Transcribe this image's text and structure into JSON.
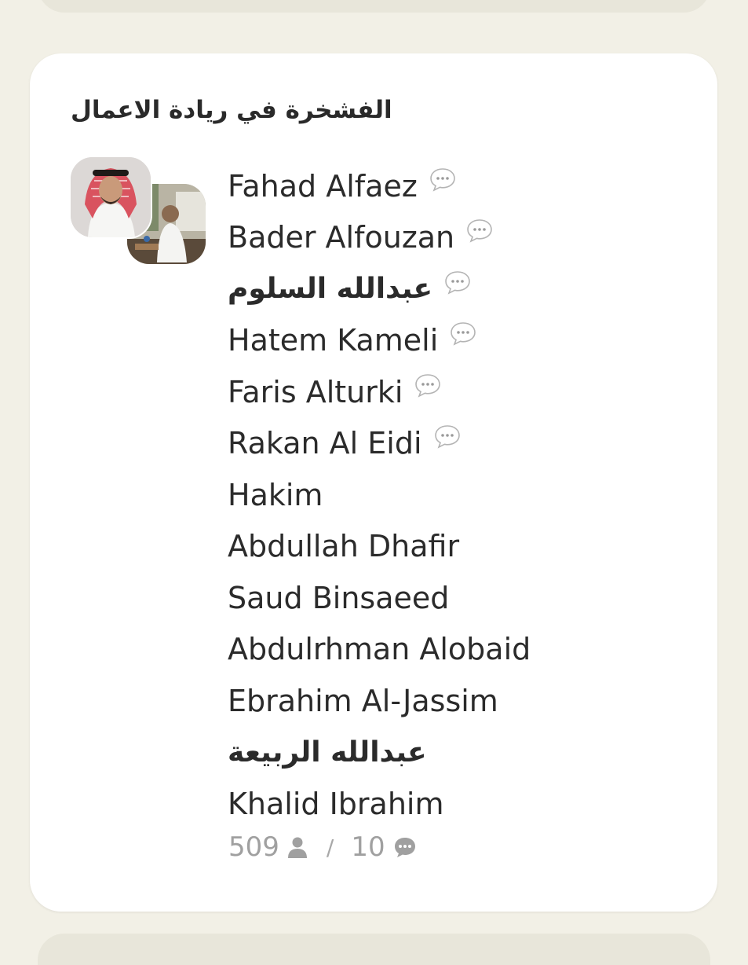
{
  "club": {
    "title": "الفشخرة في ريادة الاعمال"
  },
  "avatars": [
    {
      "name": "avatar-speaker-1"
    },
    {
      "name": "avatar-speaker-2"
    }
  ],
  "speakers": [
    {
      "name": "Fahad Alfaez",
      "has_chat_icon": true
    },
    {
      "name": "Bader Alfouzan",
      "has_chat_icon": true
    },
    {
      "name": "عبدالله السلوم",
      "has_chat_icon": true
    },
    {
      "name": "Hatem Kameli",
      "has_chat_icon": true
    },
    {
      "name": "Faris Alturki",
      "has_chat_icon": true
    },
    {
      "name": "Rakan Al Eidi",
      "has_chat_icon": true
    },
    {
      "name": "Hakim",
      "has_chat_icon": false
    },
    {
      "name": "Abdullah Dhafir",
      "has_chat_icon": false
    },
    {
      "name": "Saud Binsaeed",
      "has_chat_icon": false
    },
    {
      "name": "Abdulrhman Alobaid",
      "has_chat_icon": false
    },
    {
      "name": "Ebrahim Al-Jassim",
      "has_chat_icon": false
    },
    {
      "name": "عبدالله الربيعة",
      "has_chat_icon": false
    },
    {
      "name": "Khalid Ibrahim",
      "has_chat_icon": false
    }
  ],
  "stats": {
    "listeners": "509",
    "separator": "/",
    "speakers_count": "10"
  },
  "icons": {
    "chat": "chat-bubble-icon",
    "person": "person-icon",
    "message": "message-icon"
  },
  "colors": {
    "background": "#f2f0e6",
    "card": "#ffffff",
    "text": "#2b2b2b",
    "muted": "#a0a0a0"
  }
}
